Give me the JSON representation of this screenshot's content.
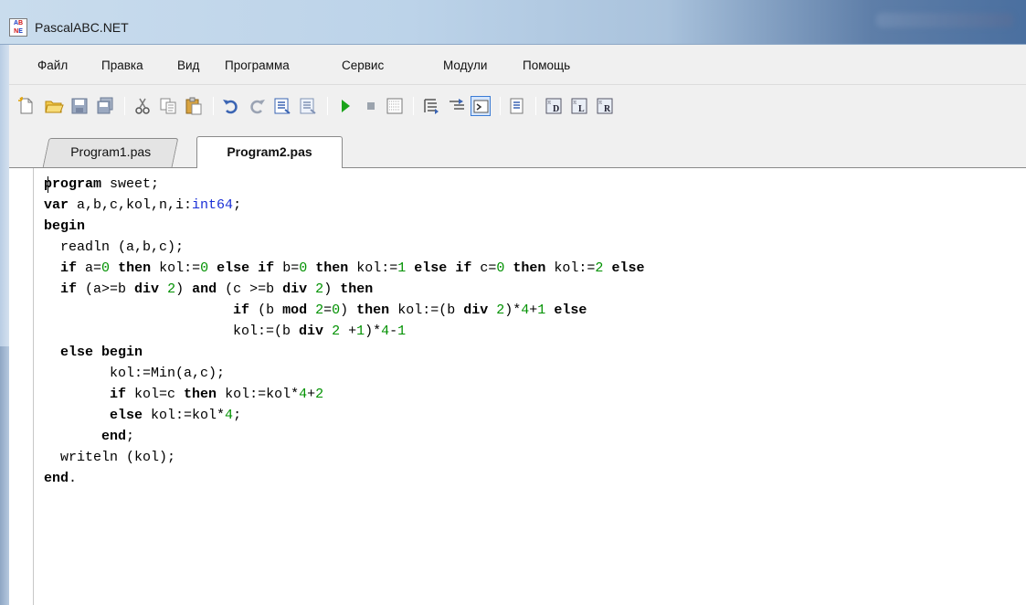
{
  "window": {
    "title": "PascalABC.NET",
    "icon": "pascalabc-app-icon"
  },
  "menu": [
    "Файл",
    "Правка",
    "Вид",
    "Программа",
    "Сервис",
    "Модули",
    "Помощь"
  ],
  "toolbar": {
    "buttons": [
      "new-file-icon",
      "open-folder-icon",
      "save-icon",
      "save-all-icon",
      "cut-icon",
      "copy-icon",
      "paste-icon",
      "undo-icon",
      "redo-icon",
      "compile-icon",
      "compile-all-icon",
      "run-icon",
      "stop-icon",
      "debug-window-icon",
      "step-into-icon",
      "step-over-icon",
      "output-window-icon",
      "properties-icon",
      "format-d-icon",
      "format-l-icon",
      "format-r-icon"
    ]
  },
  "tabs": [
    {
      "label": "Program1.pas",
      "active": false
    },
    {
      "label": "Program2.pas",
      "active": true
    }
  ],
  "code": [
    [
      [
        "t",
        "program sweet;"
      ]
    ],
    [
      [
        "t",
        "var a,b,c,kol,n,i:"
      ],
      [
        "ty",
        "int64"
      ],
      [
        "t",
        ";"
      ]
    ],
    [
      [
        "t",
        "begin"
      ]
    ],
    [
      [
        "t",
        "  readln (a,b,c);"
      ]
    ],
    [
      [
        "t",
        "  if a="
      ],
      [
        "n",
        "0"
      ],
      [
        "t",
        " then kol:="
      ],
      [
        "n",
        "0"
      ],
      [
        "t",
        " else if b="
      ],
      [
        "n",
        "0"
      ],
      [
        "t",
        " then kol:="
      ],
      [
        "n",
        "1"
      ],
      [
        "t",
        " else if c="
      ],
      [
        "n",
        "0"
      ],
      [
        "t",
        " then kol:="
      ],
      [
        "n",
        "2"
      ],
      [
        "t",
        " else"
      ]
    ],
    [
      [
        "t",
        "  if (a>=b div "
      ],
      [
        "n",
        "2"
      ],
      [
        "t",
        ") and (c >=b div "
      ],
      [
        "n",
        "2"
      ],
      [
        "t",
        ") then"
      ]
    ],
    [
      [
        "t",
        "                       if (b mod "
      ],
      [
        "n",
        "2"
      ],
      [
        "t",
        "="
      ],
      [
        "n",
        "0"
      ],
      [
        "t",
        ") then kol:=(b div "
      ],
      [
        "n",
        "2"
      ],
      [
        "t",
        ")*"
      ],
      [
        "n",
        "4"
      ],
      [
        "t",
        "+"
      ],
      [
        "n",
        "1"
      ],
      [
        "t",
        " else"
      ]
    ],
    [
      [
        "t",
        "                       kol:=(b div "
      ],
      [
        "n",
        "2"
      ],
      [
        "t",
        " +"
      ],
      [
        "n",
        "1"
      ],
      [
        "t",
        ")*"
      ],
      [
        "n",
        "4"
      ],
      [
        "t",
        "-"
      ],
      [
        "n",
        "1"
      ]
    ],
    [
      [
        "t",
        "  else begin"
      ]
    ],
    [
      [
        "t",
        "        kol:=Min(a,c);"
      ]
    ],
    [
      [
        "t",
        "        if kol=c then kol:=kol*"
      ],
      [
        "n",
        "4"
      ],
      [
        "t",
        "+"
      ],
      [
        "n",
        "2"
      ]
    ],
    [
      [
        "t",
        "        else kol:=kol*"
      ],
      [
        "n",
        "4"
      ],
      [
        "t",
        ";"
      ]
    ],
    [
      [
        "t",
        "       end;"
      ]
    ],
    [
      [
        "t",
        "  writeln (kol);"
      ]
    ],
    [
      [
        "t",
        "end."
      ]
    ]
  ],
  "colors": {
    "number": "#009100",
    "type": "#1a2fd6",
    "accent": "#3b7bd5"
  }
}
